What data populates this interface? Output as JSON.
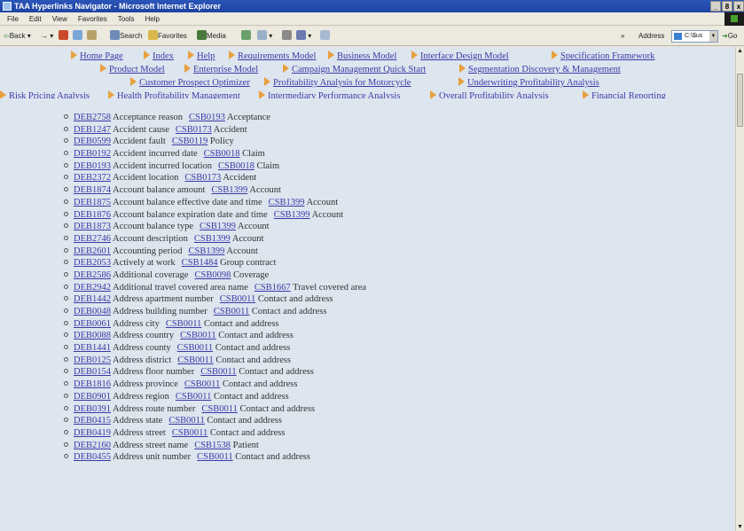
{
  "window": {
    "title": "TAA Hyperlinks Navigator - Microsoft Internet Explorer",
    "controls": [
      "_",
      "8",
      "x"
    ]
  },
  "menu": [
    "File",
    "Edit",
    "View",
    "Favorites",
    "Tools",
    "Help"
  ],
  "toolbar": {
    "back": "Back",
    "forward": "→",
    "search": "Search",
    "favorites": "Favorites",
    "media": "Media",
    "chevron": "»",
    "address_label": "Address",
    "address_value": "C:\\$us",
    "go": "Go"
  },
  "nav": {
    "row1": [
      "Home Page",
      "Index",
      "Help",
      "Requirements Model",
      "Business Model",
      "Interface Design Model",
      "Specification Framework"
    ],
    "row2": [
      "Product Model",
      "Enterprise Model",
      "Campaign Management Quick Start",
      "Segmentation Discovery & Management"
    ],
    "row3": [
      "Customer Prospect Optimizer",
      "Profitability Analysis for Motorcycle",
      "Underwriting Profitability Analysis"
    ],
    "row4": [
      "Risk Pricing Analysis",
      "Health Profitability Management",
      "Intermediary Performance Analysis",
      "Overall Profitability Analysis",
      "Financial Reporting"
    ]
  },
  "items": [
    {
      "deb": "DEB2758",
      "name": "Acceptance reason",
      "csb": "CSB0193",
      "entity": "Acceptance"
    },
    {
      "deb": "DEB1247",
      "name": "Accident cause",
      "csb": "CSB0173",
      "entity": "Accident"
    },
    {
      "deb": "DEB0599",
      "name": "Accident fault",
      "csb": "CSB0119",
      "entity": "Policy"
    },
    {
      "deb": "DEB0192",
      "name": "Accident incurred date",
      "csb": "CSB0018",
      "entity": "Claim"
    },
    {
      "deb": "DEB0193",
      "name": "Accident incurred location",
      "csb": "CSB0018",
      "entity": "Claim"
    },
    {
      "deb": "DEB2372",
      "name": "Accident location",
      "csb": "CSB0173",
      "entity": "Accident"
    },
    {
      "deb": "DEB1874",
      "name": "Account balance amount",
      "csb": "CSB1399",
      "entity": "Account"
    },
    {
      "deb": "DEB1875",
      "name": "Account balance effective date and time",
      "csb": "CSB1399",
      "entity": "Account"
    },
    {
      "deb": "DEB1876",
      "name": "Account balance expiration date and time",
      "csb": "CSB1399",
      "entity": "Account"
    },
    {
      "deb": "DEB1873",
      "name": "Account balance type",
      "csb": "CSB1399",
      "entity": "Account"
    },
    {
      "deb": "DEB2746",
      "name": "Account description",
      "csb": "CSB1399",
      "entity": "Account"
    },
    {
      "deb": "DEB2601",
      "name": "Accounting period",
      "csb": "CSB1399",
      "entity": "Account"
    },
    {
      "deb": "DEB2053",
      "name": "Actively at work",
      "csb": "CSB1484",
      "entity": "Group contract"
    },
    {
      "deb": "DEB2586",
      "name": "Additional coverage",
      "csb": "CSB0098",
      "entity": "Coverage"
    },
    {
      "deb": "DEB2942",
      "name": "Additional travel covered area name",
      "csb": "CSB1667",
      "entity": "Travel covered area"
    },
    {
      "deb": "DEB1442",
      "name": "Address apartment number",
      "csb": "CSB0011",
      "entity": "Contact and address"
    },
    {
      "deb": "DEB0048",
      "name": "Address building number",
      "csb": "CSB0011",
      "entity": "Contact and address"
    },
    {
      "deb": "DEB0061",
      "name": "Address city",
      "csb": "CSB0011",
      "entity": "Contact and address"
    },
    {
      "deb": "DEB0088",
      "name": "Address country",
      "csb": "CSB0011",
      "entity": "Contact and address"
    },
    {
      "deb": "DEB1441",
      "name": "Address county",
      "csb": "CSB0011",
      "entity": "Contact and address"
    },
    {
      "deb": "DEB0125",
      "name": "Address district",
      "csb": "CSB0011",
      "entity": "Contact and address"
    },
    {
      "deb": "DEB0154",
      "name": "Address floor number",
      "csb": "CSB0011",
      "entity": "Contact and address"
    },
    {
      "deb": "DEB1816",
      "name": "Address province",
      "csb": "CSB0011",
      "entity": "Contact and address"
    },
    {
      "deb": "DEB0901",
      "name": "Address region",
      "csb": "CSB0011",
      "entity": "Contact and address"
    },
    {
      "deb": "DEB0391",
      "name": "Address route number",
      "csb": "CSB0011",
      "entity": "Contact and address"
    },
    {
      "deb": "DEB0415",
      "name": "Address state",
      "csb": "CSB0011",
      "entity": "Contact and address"
    },
    {
      "deb": "DEB0419",
      "name": "Address street",
      "csb": "CSB0011",
      "entity": "Contact and address"
    },
    {
      "deb": "DEB2160",
      "name": "Address street name",
      "csb": "CSB1538",
      "entity": "Patient"
    },
    {
      "deb": "DEB0455",
      "name": "Address unit number",
      "csb": "CSB0011",
      "entity": "Contact and address"
    }
  ]
}
